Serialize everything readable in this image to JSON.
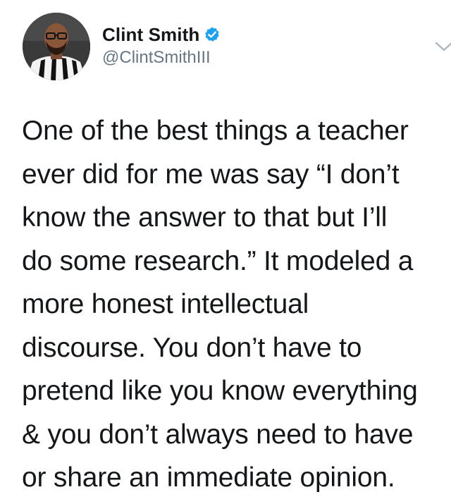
{
  "author": {
    "display_name": "Clint Smith",
    "handle": "@ClintSmithIII",
    "verified": true,
    "avatar_icon": "user-avatar"
  },
  "tweet": {
    "lines": [
      "One of the best things a teacher",
      "ever did for me was say “I don’t",
      "know the answer to that but I’ll",
      "do some research.” It modeled a",
      "more honest intellectual",
      "discourse. You don’t have to",
      "pretend like you know everything",
      "& you don’t always need to have",
      "or share an immediate opinion."
    ]
  },
  "menu": {
    "icon": "chevron-down-icon"
  },
  "colors": {
    "text": "#14171a",
    "secondary": "#657786",
    "verified": "#1da1f2",
    "caret": "#aab8c2",
    "background": "#ffffff"
  }
}
